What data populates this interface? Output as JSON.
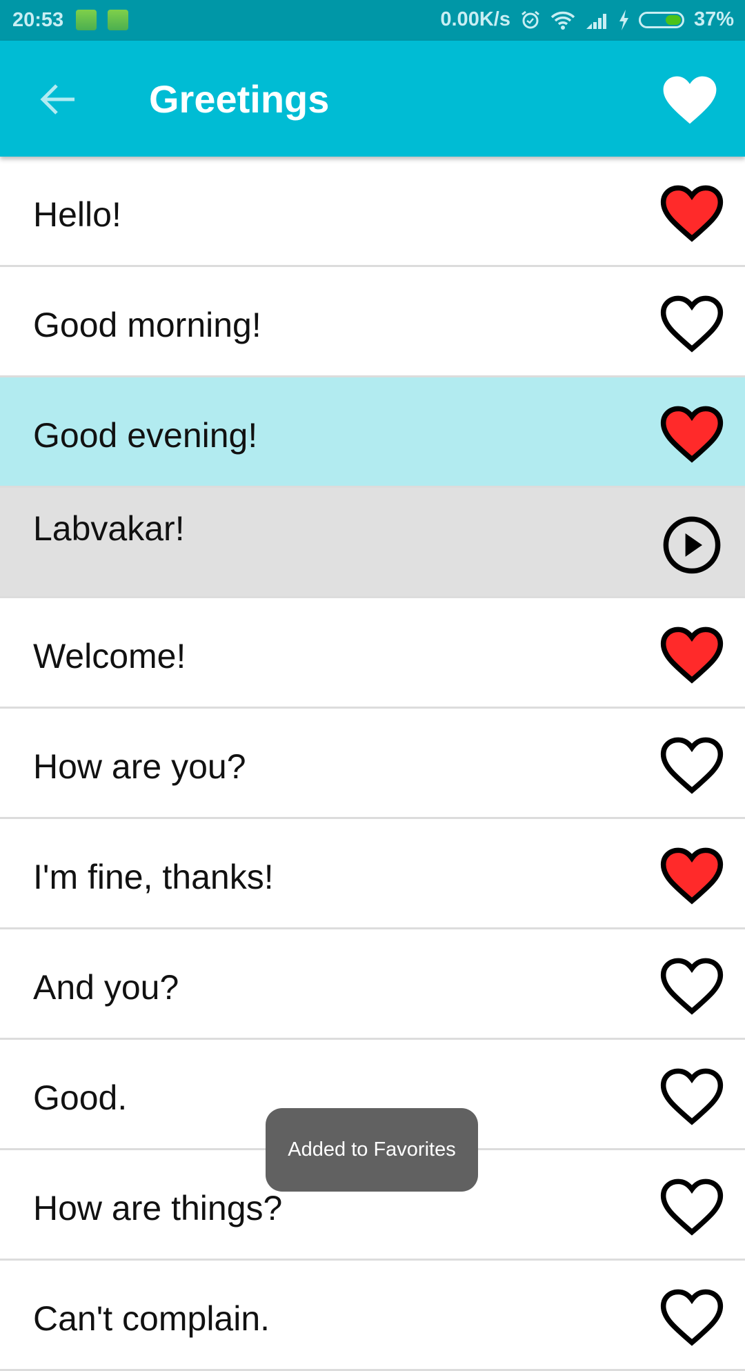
{
  "status_bar": {
    "time": "20:53",
    "notification_icons": [
      "battery-saver-icon",
      "android-app-icon"
    ],
    "net_speed": "0.00K/s",
    "icons": [
      "alarm-icon",
      "wifi-icon",
      "signal-icon",
      "charging-icon"
    ],
    "battery_percent": "37%",
    "battery_level": 0.37
  },
  "app_bar": {
    "title": "Greetings",
    "back_icon": "arrow-back-icon",
    "favorites_icon": "heart-filled-icon"
  },
  "colors": {
    "status_bar": "#0097a7",
    "app_bar": "#00bcd4",
    "selected_row": "#b2ebf0",
    "playing_row": "#e0e0e0",
    "heart_fill": "#ff2a2a"
  },
  "phrases": [
    {
      "text": "Hello!",
      "favorite": true,
      "state": "normal"
    },
    {
      "text": "Good morning!",
      "favorite": false,
      "state": "normal"
    },
    {
      "text": "Good evening!",
      "favorite": true,
      "state": "selected"
    },
    {
      "text": "Labvakar!",
      "favorite": false,
      "state": "playing"
    },
    {
      "text": "Welcome!",
      "favorite": true,
      "state": "normal"
    },
    {
      "text": "How are you?",
      "favorite": false,
      "state": "normal"
    },
    {
      "text": "I'm fine, thanks!",
      "favorite": true,
      "state": "normal"
    },
    {
      "text": "And you?",
      "favorite": false,
      "state": "normal"
    },
    {
      "text": "Good.",
      "favorite": false,
      "state": "normal"
    },
    {
      "text": "How are things?",
      "favorite": false,
      "state": "normal"
    },
    {
      "text": "Can't complain.",
      "favorite": false,
      "state": "normal"
    }
  ],
  "toast": {
    "message": "Added to Favorites"
  }
}
